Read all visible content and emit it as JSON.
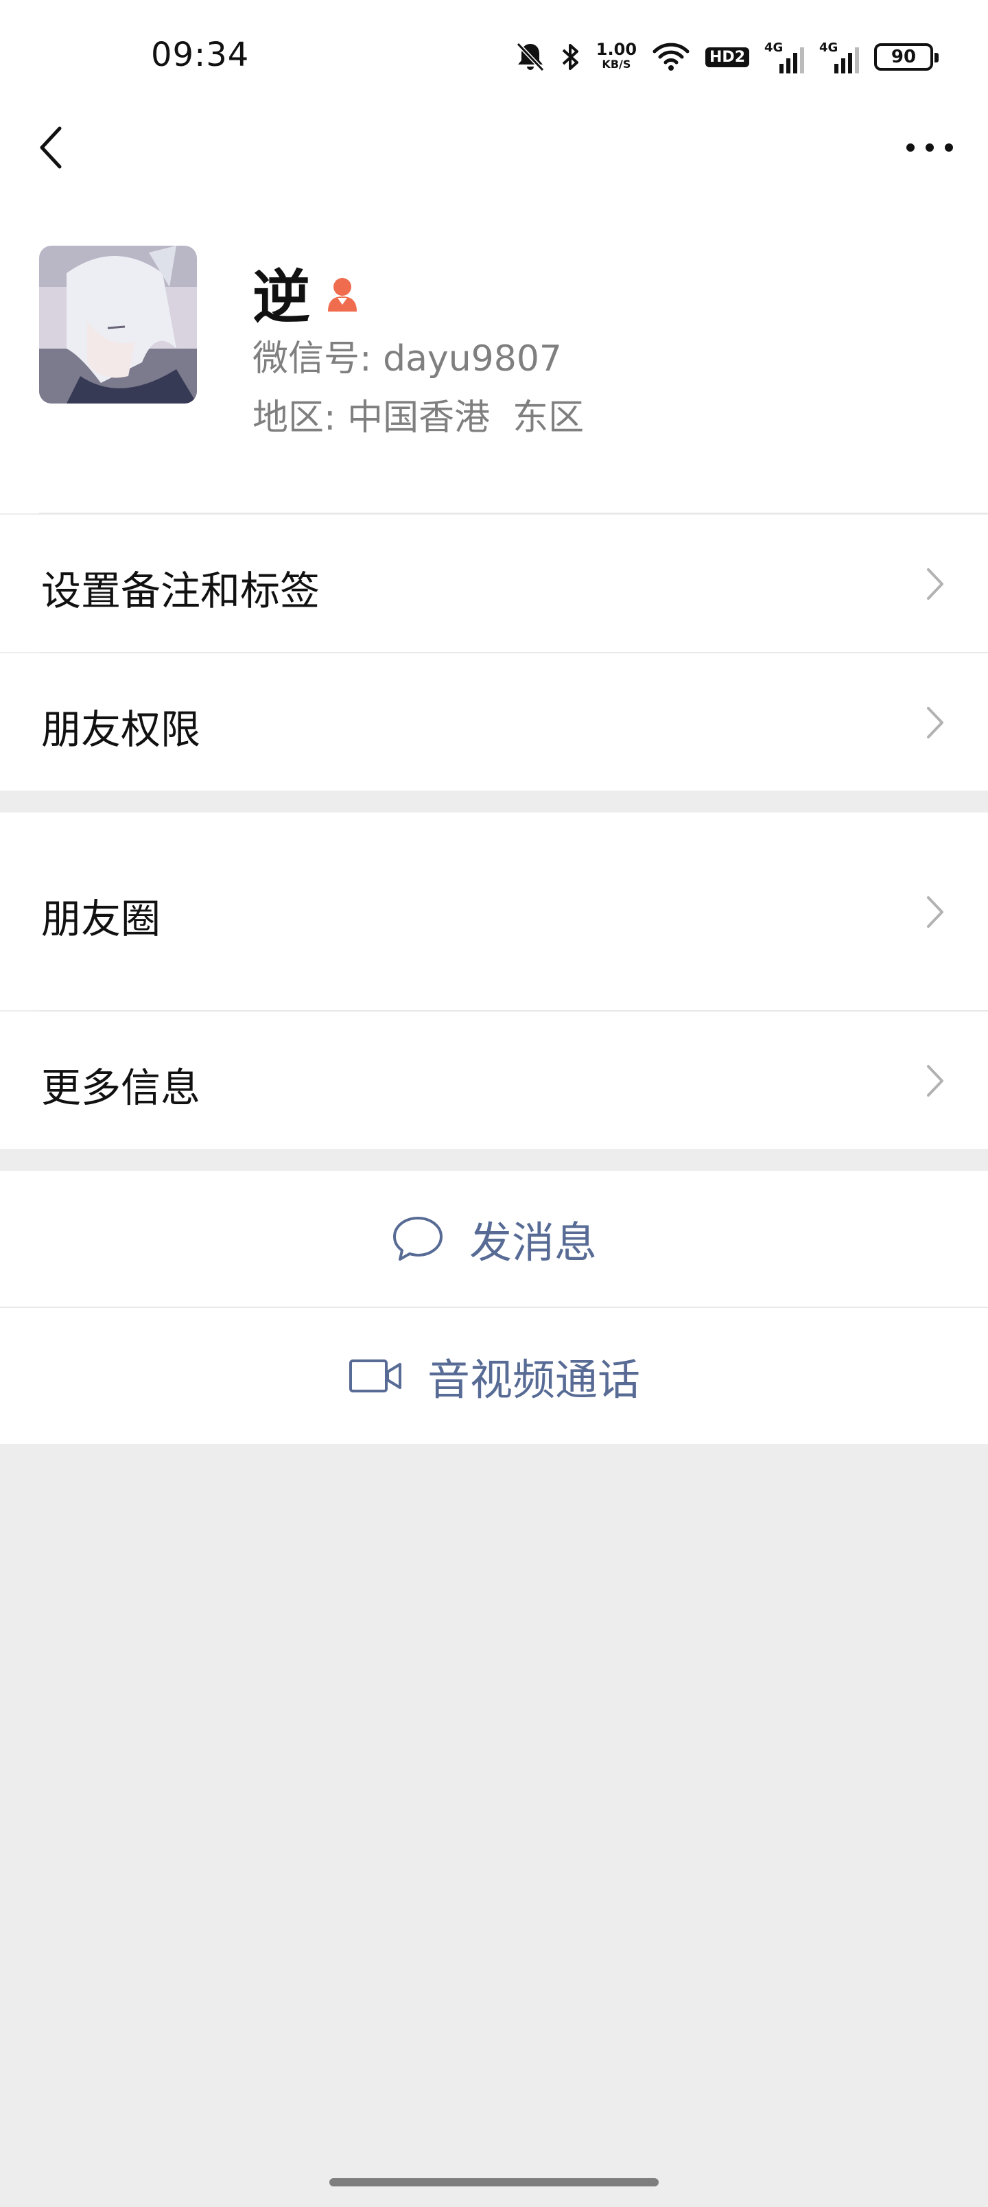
{
  "status_bar": {
    "time": "09:34",
    "net_speed_value": "1.00",
    "net_speed_unit": "KB/S",
    "hd_label": "HD2",
    "network_1": "4G",
    "network_2": "4G",
    "battery": "90",
    "icons": [
      "bell-muted-icon",
      "bluetooth-icon",
      "wifi-icon",
      "hd-icon",
      "signal-icon",
      "signal-icon",
      "battery-icon"
    ]
  },
  "nav": {
    "back_icon": "chevron-left-icon",
    "more_icon": "more-dots-icon"
  },
  "profile": {
    "name": "逆",
    "gender_icon": "female-icon",
    "wechat_id_label": "微信号:",
    "wechat_id": "dayu9807",
    "region_label": "地区:",
    "region": "中国香港  东区"
  },
  "cells": {
    "remark_tags": "设置备注和标签",
    "friend_permissions": "朋友权限",
    "moments": "朋友圈",
    "more_info": "更多信息"
  },
  "actions": {
    "message": "发消息",
    "video_call": "音视频通话"
  },
  "colors": {
    "link": "#576b95",
    "gender_icon": "#ef6d4e",
    "background": "#ededed"
  }
}
